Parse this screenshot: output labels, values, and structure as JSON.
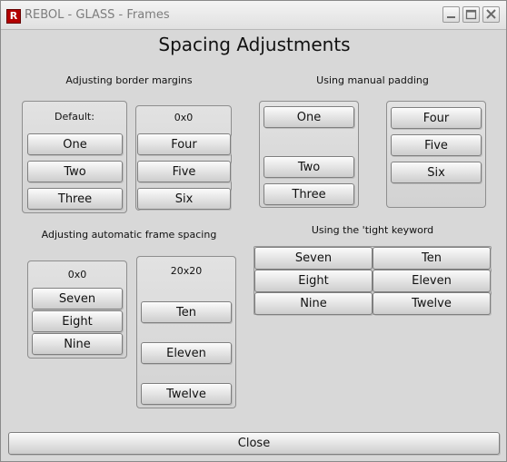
{
  "window": {
    "app_icon_letter": "R",
    "title": "REBOL - GLASS - Frames"
  },
  "heading": "Spacing Adjustments",
  "sections": {
    "border_margins": {
      "label": "Adjusting border margins",
      "default_panel": {
        "label": "Default:",
        "buttons": [
          "One",
          "Two",
          "Three"
        ]
      },
      "zero_panel": {
        "label": "0x0",
        "buttons": [
          "Four",
          "Five",
          "Six"
        ]
      }
    },
    "manual_padding": {
      "label": "Using manual padding",
      "left_panel": {
        "buttons": [
          "One",
          "Two",
          "Three"
        ]
      },
      "right_panel": {
        "buttons": [
          "Four",
          "Five",
          "Six"
        ]
      }
    },
    "auto_spacing": {
      "label": "Adjusting automatic frame spacing",
      "left_panel": {
        "label": "0x0",
        "buttons": [
          "Seven",
          "Eight",
          "Nine"
        ]
      },
      "right_panel": {
        "label": "20x20",
        "buttons": [
          "Ten",
          "Eleven",
          "Twelve"
        ]
      }
    },
    "tight": {
      "label": "Using the 'tight keyword",
      "rows": [
        [
          "Seven",
          "Ten"
        ],
        [
          "Eight",
          "Eleven"
        ],
        [
          "Nine",
          "Twelve"
        ]
      ]
    }
  },
  "close_label": "Close"
}
